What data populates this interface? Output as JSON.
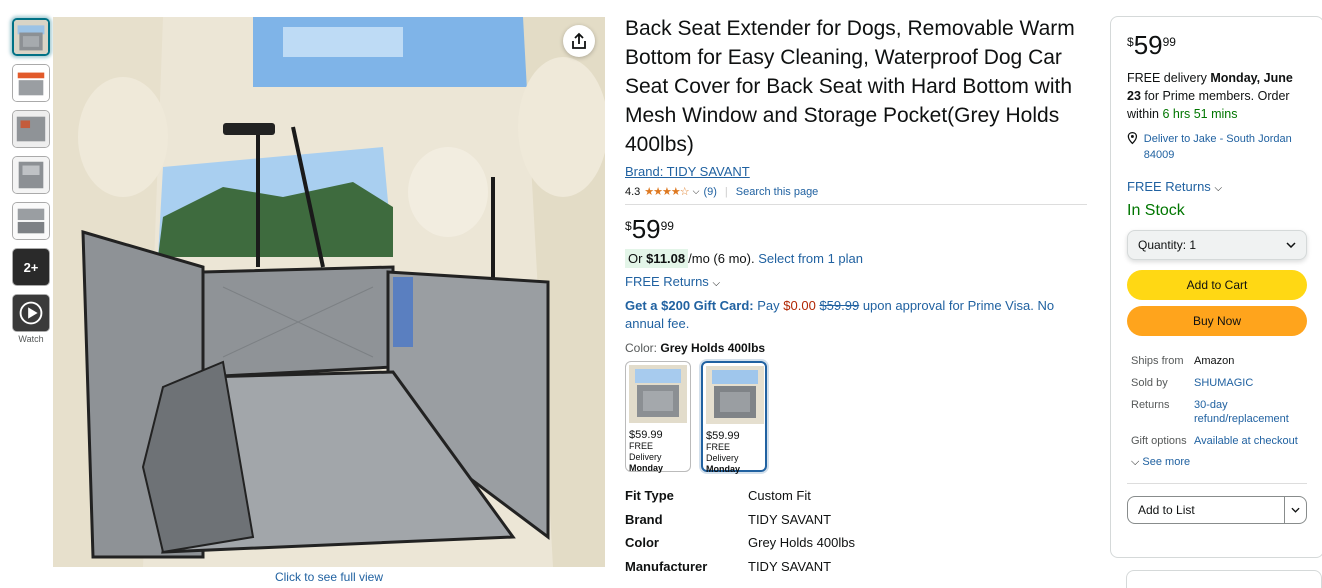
{
  "gallery": {
    "thumbnails": [
      "seat-extender-main",
      "product-angle-2",
      "product-angle-3",
      "product-angle-4",
      "product-angle-5"
    ],
    "more_count": "2+",
    "watch_label": "Watch",
    "full_view_link": "Click to see full view"
  },
  "product": {
    "title": "Back Seat Extender for Dogs, Removable Warm Bottom for Easy Cleaning, Waterproof Dog Car Seat Cover for Back Seat with Hard Bottom with Mesh Window and Storage Pocket(Grey Holds 400lbs)",
    "brand_link": "Brand: TIDY SAVANT",
    "rating": "4.3",
    "stars": 4.3,
    "review_count": "(9)",
    "search_page": "Search this page",
    "price_symbol": "$",
    "price_whole": "59",
    "price_fraction": "99",
    "monthly_prefix": "Or",
    "monthly_amount": "$11.08",
    "monthly_suffix": "/mo (6 mo).",
    "monthly_plan_link": "Select from 1 plan",
    "free_returns": "FREE Returns",
    "giftcard_bold": "Get a $200 Gift Card:",
    "giftcard_pay": "Pay",
    "giftcard_zero": "$0.00",
    "giftcard_strike": "$59.99",
    "giftcard_rest": "upon approval for Prime Visa. No annual fee.",
    "color_label": "Color:",
    "color_value": "Grey Holds 400lbs",
    "swatches": [
      {
        "price": "$59.99",
        "delivery": "FREE Delivery",
        "day": "Monday"
      },
      {
        "price": "$59.99",
        "delivery": "FREE Delivery",
        "day": "Monday"
      }
    ],
    "specs": [
      {
        "key": "Fit Type",
        "value": "Custom Fit"
      },
      {
        "key": "Brand",
        "value": "TIDY SAVANT"
      },
      {
        "key": "Color",
        "value": "Grey Holds 400lbs"
      },
      {
        "key": "Manufacturer",
        "value": "TIDY SAVANT"
      }
    ]
  },
  "buybox": {
    "price_symbol": "$",
    "price_whole": "59",
    "price_fraction": "99",
    "delivery_prefix": "FREE delivery",
    "delivery_date": "Monday, June 23",
    "delivery_mid": "for Prime members. Order within",
    "delivery_timer": "6 hrs 51 mins",
    "deliver_to": "Deliver to Jake - South Jordan 84009",
    "free_returns": "FREE Returns",
    "stock": "In Stock",
    "quantity": "Quantity:  1",
    "add_to_cart": "Add to Cart",
    "buy_now": "Buy Now",
    "facts": [
      {
        "key": "Ships from",
        "value": "Amazon"
      },
      {
        "key": "Sold by",
        "value": "SHUMAGIC"
      },
      {
        "key": "Returns",
        "value": "30-day refund/replacement"
      },
      {
        "key": "Gift options",
        "value": "Available at checkout"
      }
    ],
    "see_more": "See more",
    "add_to_list": "Add to List"
  },
  "colors": {
    "link": "#2162a1",
    "stock_green": "#007600",
    "cart_yellow": "#ffd814",
    "buy_orange": "#ffa41c",
    "star_orange": "#de7921"
  }
}
